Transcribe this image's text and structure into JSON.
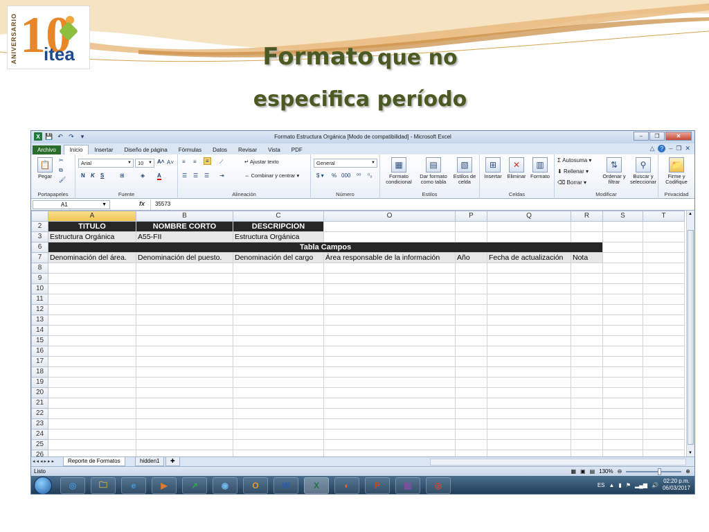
{
  "slide": {
    "logo_text": "itea",
    "logo_number": "10",
    "logo_anniversary": "ANIVERSARIO",
    "title_big": "Formato",
    "title_small": "que no",
    "title_line2": "especifica período"
  },
  "window": {
    "title": "Formato Estructura Orgánica  [Modo de compatibilidad] - Microsoft Excel",
    "minimize": "–",
    "restore": "❐",
    "close": "✕"
  },
  "tabs": [
    "Archivo",
    "Inicio",
    "Insertar",
    "Diseño de página",
    "Fórmulas",
    "Datos",
    "Revisar",
    "Vista",
    "PDF"
  ],
  "ribbon": {
    "paste": "Pegar",
    "portapapeles": "Portapapeles",
    "font_name": "Arial",
    "font_size": "10",
    "fuente": "Fuente",
    "bold": "N",
    "italic": "K",
    "underline": "S",
    "ajustar": "Ajustar texto",
    "combinar": "Combinar y centrar",
    "alineacion": "Alineación",
    "number_format": "General",
    "numero": "Número",
    "formato_condicional": "Formato condicional",
    "dar_formato": "Dar formato como tabla",
    "estilos_celda": "Estilos de celda",
    "estilos": "Estilos",
    "insertar": "Insertar",
    "eliminar": "Eliminar",
    "formato": "Formato",
    "celdas": "Celdas",
    "autosuma": "Autosuma",
    "rellenar": "Rellenar",
    "borrar": "Borrar",
    "ordenar": "Ordenar y filtrar",
    "buscar": "Buscar y seleccionar",
    "modificar": "Modificar",
    "firme": "Firme y Codifique",
    "privacidad": "Privacidad"
  },
  "formula": {
    "cell_ref": "A1",
    "fx": "fx",
    "value": "35573"
  },
  "columns": [
    "A",
    "B",
    "C",
    "O",
    "P",
    "Q",
    "R",
    "S",
    "T"
  ],
  "rows": {
    "r2": {
      "num": "2",
      "a": "TITULO",
      "b": "NOMBRE CORTO",
      "c": "DESCRIPCION"
    },
    "r3": {
      "num": "3",
      "a": "Estructura Orgánica",
      "b": "A55-FII",
      "c": "Estructura Orgánica"
    },
    "r6": {
      "num": "6",
      "merged": "Tabla Campos"
    },
    "r7": {
      "num": "7",
      "a": "Denominación del área.",
      "b": "Denominación del puesto.",
      "c": "Denominación del cargo",
      "o": "Área responsable de la información",
      "p": "Año",
      "q": "Fecha de actualización",
      "r": "Nota"
    }
  },
  "empty_rows": [
    "8",
    "9",
    "10",
    "11",
    "12",
    "13",
    "14",
    "15",
    "16",
    "17",
    "18",
    "19",
    "20",
    "21",
    "22",
    "23",
    "24",
    "25",
    "26"
  ],
  "sheets": [
    "Reporte de Formatos",
    "hidden1"
  ],
  "status": {
    "ready": "Listo",
    "zoom": "130%"
  },
  "taskbar": {
    "lang": "ES",
    "time": "02:20 p.m.",
    "date": "06/03/2017",
    "apps": [
      "chrome-icon",
      "explorer-icon",
      "ie-icon",
      "media-icon",
      "finance-icon",
      "wifi-icon",
      "outlook-icon",
      "word-icon",
      "excel-icon",
      "firefox-icon",
      "powerpoint-icon",
      "winrar-icon",
      "chrome2-icon"
    ]
  }
}
